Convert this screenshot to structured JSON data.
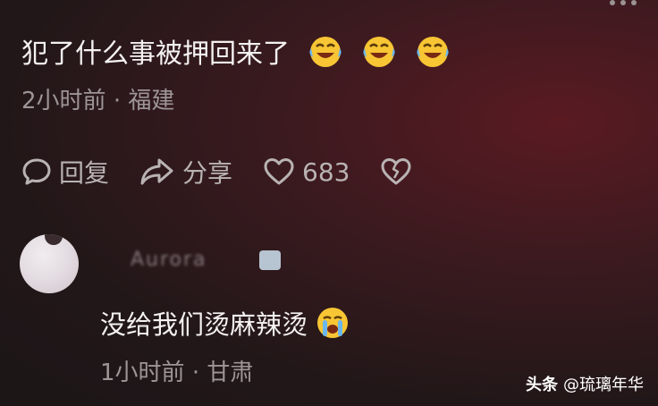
{
  "top_comment": {
    "text": "犯了什么事被押回来了",
    "emojis": [
      "rofl-emoji",
      "rofl-emoji",
      "rofl-emoji"
    ],
    "time": "2小时前",
    "location": "福建",
    "separator": "·"
  },
  "actions": {
    "reply_label": "回复",
    "share_label": "分享",
    "like_count": "683"
  },
  "reply": {
    "username": "Aurora",
    "text": "没给我们烫麻辣烫",
    "emoji": "crying-emoji",
    "time": "1小时前",
    "location": "甘肃",
    "separator": "·"
  },
  "watermark": {
    "brand": "头条",
    "handle": "@琉璃年华"
  },
  "colors": {
    "text_primary": "#f4f1f1",
    "text_secondary": "#9d9596",
    "icon": "#b9b3b3"
  }
}
